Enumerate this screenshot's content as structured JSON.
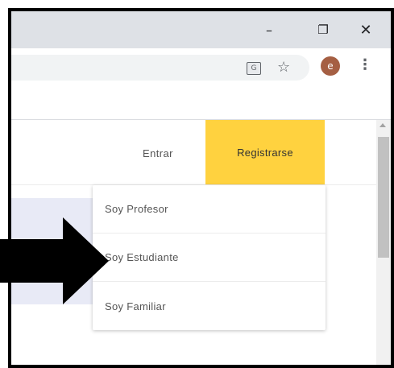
{
  "window_controls": {
    "minimize": "–",
    "maximize": "❐",
    "close": "✕"
  },
  "toolbar": {
    "translate_glyph": "G",
    "star_glyph": "☆",
    "avatar_initial": "e",
    "menu_glyph": "⋮"
  },
  "header": {
    "login_label": "Entrar",
    "register_label": "Registrarse"
  },
  "dropdown": {
    "items": [
      {
        "label": "Soy Profesor"
      },
      {
        "label": "Soy Estudiante"
      },
      {
        "label": "Soy Familiar"
      }
    ]
  },
  "colors": {
    "accent": "#ffd23f",
    "titlebar": "#dee1e6",
    "avatar": "#a55f43",
    "banner": "#e8eaf6"
  },
  "icons": [
    "minimize-icon",
    "maximize-icon",
    "close-icon",
    "translate-icon",
    "star-icon",
    "menu-icon",
    "pointer-arrow"
  ]
}
